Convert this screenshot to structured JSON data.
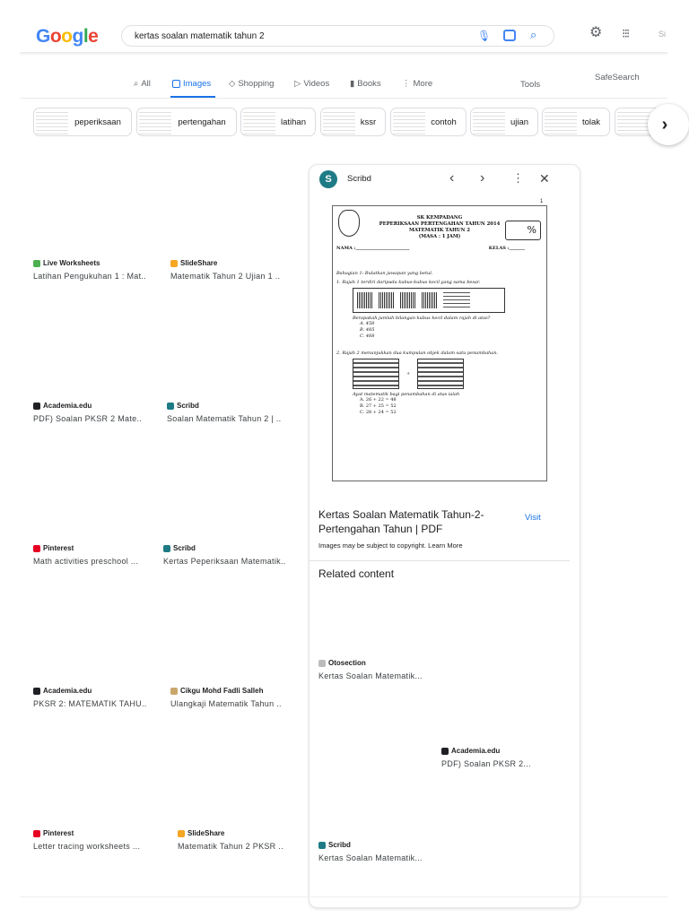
{
  "header": {
    "logo": "Google",
    "query": "kertas soalan matematik tahun 2",
    "signin_partial": "Si"
  },
  "tabs": [
    {
      "label": "All",
      "icon": "search-icon"
    },
    {
      "label": "Images",
      "icon": "image-icon"
    },
    {
      "label": "Shopping",
      "icon": "tag-icon"
    },
    {
      "label": "Videos",
      "icon": "play-icon"
    },
    {
      "label": "Books",
      "icon": "book-icon"
    },
    {
      "label": "More",
      "icon": "more-vert-icon"
    }
  ],
  "tools": "Tools",
  "safesearch": "SafeSearch",
  "chips": [
    "peperiksaan",
    "pertengahan",
    "latihan",
    "kssr",
    "contoh",
    "ujian",
    "tolak"
  ],
  "results": [
    {
      "source": "Live Worksheets",
      "title": "Latihan Pengukuhan 1 : Mat..",
      "color": "#4caf50"
    },
    {
      "source": "SlideShare",
      "title": "Matematik Tahun 2 Ujian 1 ..",
      "color": "#f5a623"
    },
    {
      "source": "Academia.edu",
      "title": "PDF) Soalan PKSR 2 Mate..",
      "color": "#202124"
    },
    {
      "source": "Scribd",
      "title": "Soalan Matematik Tahun 2 | ..",
      "color": "#1e7b85"
    },
    {
      "source": "Pinterest",
      "title": "Math activities preschool ...",
      "color": "#e60023"
    },
    {
      "source": "Scribd",
      "title": "Kertas Peperiksaan Matematik..",
      "color": "#1e7b85"
    },
    {
      "source": "Academia.edu",
      "title": "PKSR 2: MATEMATIK TAHU..",
      "color": "#202124"
    },
    {
      "source": "Cikgu Mohd Fadli Salleh",
      "title": "Ulangkaji Matematik Tahun ..",
      "color": "#c9a66b"
    },
    {
      "source": "Pinterest",
      "title": "Letter tracing worksheets ...",
      "color": "#e60023"
    },
    {
      "source": "SlideShare",
      "title": "Matematik Tahun 2 PKSR ..",
      "color": "#f5a623"
    }
  ],
  "panel": {
    "source": "Scribd",
    "title": "Kertas Soalan Matematik Tahun-2-Pertengahan Tahun | PDF",
    "visit": "Visit",
    "copyright": "Images may be subject to copyright.",
    "learn_more": "Learn More",
    "related_heading": "Related content",
    "doc": {
      "page_no": "1",
      "school": "SK KEMPADANG",
      "exam": "PEPERIKSAAN PERTENGAHAN TAHUN 2014",
      "subject": "MATEMATIK TAHUN 2",
      "time": "(MASA : 1 JAM)",
      "percent": "%",
      "nama": "NAMA :________________________",
      "kelas": "KELAS :_______",
      "section": "Bahagian 1: Bulatkan jawapan yang betul.",
      "q1": "1.   Rajah 1 terdiri daripada kubus-kubus kecil yang sama besar.",
      "q1b": "Berapakah jumlah bilangan kubus kecil dalam rajah di atas?",
      "q1opts": [
        "A.   458",
        "B.   485",
        "C.   488"
      ],
      "q2": "2.   Rajah 2 menunjukkan dua kumpulan objek dalam satu penambahan.",
      "plus": "+",
      "q2b": "Ayat matematik bagi penambahan di atas ialah",
      "q2opts": [
        "A.   26 + 22 = 48",
        "B.   27 + 25 = 52",
        "C.   28 + 24 = 52"
      ]
    },
    "related": [
      {
        "source": "Otosection",
        "title": "Kertas Soalan Matematik..."
      },
      {
        "source": "Academia.edu",
        "title": "PDF) Soalan PKSR 2..."
      },
      {
        "source": "Scribd",
        "title": "Kertas Soalan Matematik..."
      }
    ]
  }
}
